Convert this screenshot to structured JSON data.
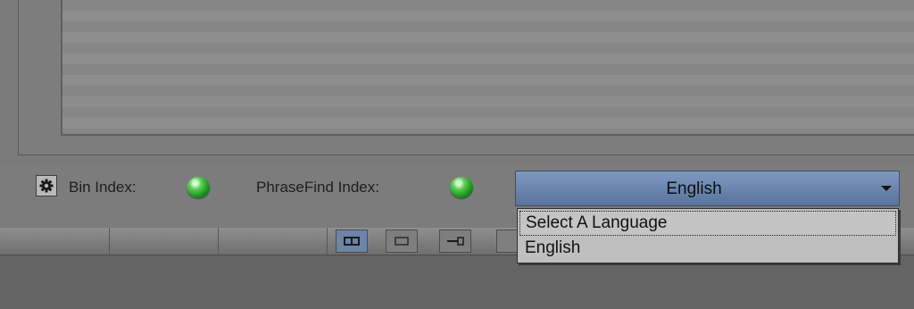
{
  "status_bar": {
    "bin_index_label": "Bin Index:",
    "phrasefind_index_label": "PhraseFind Index:",
    "bin_index_status": "green",
    "phrasefind_index_status": "green"
  },
  "language_select": {
    "selected": "English",
    "options": [
      "Select A Language",
      "English"
    ]
  },
  "icons": {
    "settings": "gear-icon",
    "dropdown": "chevron-down-icon"
  },
  "colors": {
    "led_green": "#2bb02c",
    "select_blue": "#6a86ae",
    "dropdown_bg": "#bfbfbf"
  }
}
